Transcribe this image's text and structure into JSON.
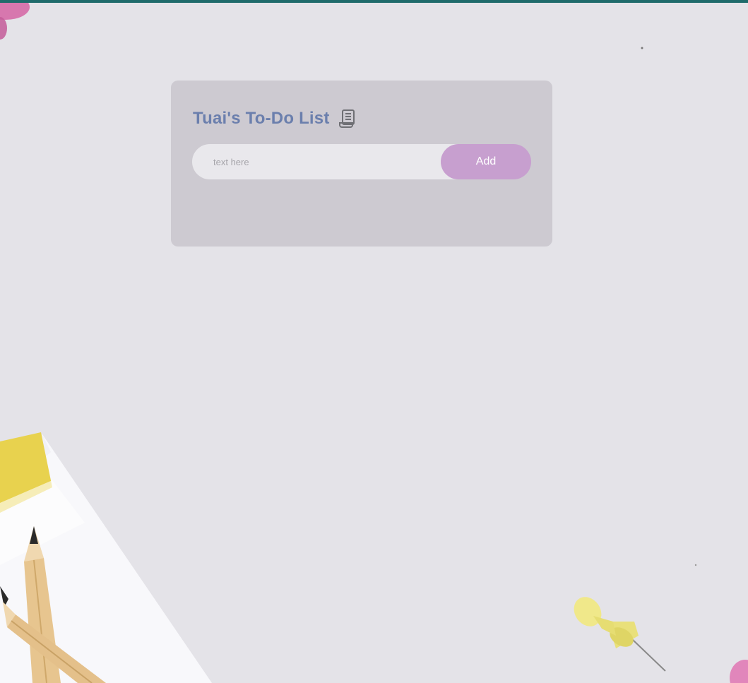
{
  "app": {
    "title": "Tuai's To-Do List",
    "title_icon": "scroll-list-icon"
  },
  "task_form": {
    "input_value": "",
    "input_placeholder": "text here",
    "add_label": "Add"
  },
  "theme": {
    "title_color": "#6b7fad",
    "add_button_color": "#c79fcf",
    "card_background": "#c4c1c7",
    "top_strip_color": "#1f6b6b",
    "page_background": "#e4e3e8"
  },
  "background": {
    "description_icons": [
      "sticky-note-icon",
      "pencil-icon",
      "push-pin-icon"
    ]
  }
}
